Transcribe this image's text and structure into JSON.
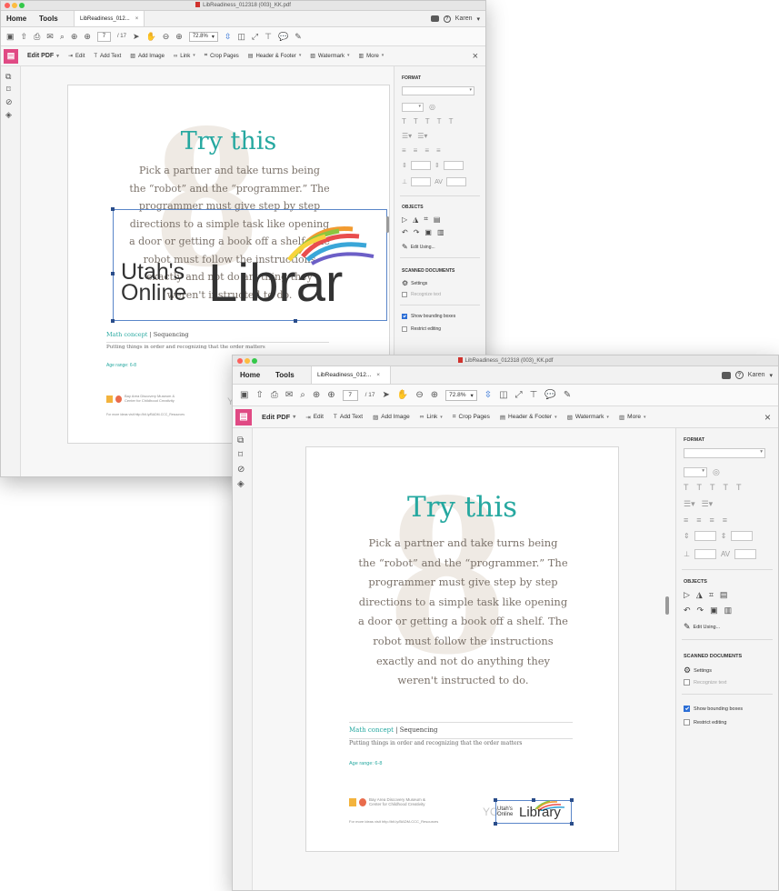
{
  "title": "LibReadiness_012318 (003)_KK.pdf",
  "back_title": "LibReadiness_012318 (003)_KK.pdf",
  "tabs": {
    "home": "Home",
    "tools": "Tools",
    "doc": "LibReadiness_012...",
    "close": "×"
  },
  "user": "Karen",
  "help_glyph": "?",
  "page_current": "7",
  "page_total": "/ 17",
  "zoom": "72.8%",
  "edit": {
    "title": "Edit PDF",
    "edit": "Edit",
    "add_text": "Add Text",
    "add_image": "Add Image",
    "link": "Link",
    "crop": "Crop Pages",
    "header_footer": "Header & Footer",
    "watermark": "Watermark",
    "more": "More",
    "close": "×"
  },
  "doc": {
    "ghost": "8",
    "heading": "Try this",
    "body_lines": [
      "Pick a partner and take turns being",
      "the “robot” and the “programmer.” The",
      "programmer must give step by step",
      "directions to a simple task like opening",
      "a door or getting a book off a shelf. The",
      "robot must follow the instructions",
      "exactly and not do anything they",
      "weren't instructed to do."
    ],
    "concept_label": "Math concept",
    "concept_sep": "|",
    "concept_value": "Sequencing",
    "description": "Putting things in order and recognizing that the order matters",
    "age_range": "Age range: 6-8",
    "museum_line1": "Bay Area Discovery Museum &",
    "museum_line2": "Center for Childhood Creativity",
    "more_ideas": "For more ideas visit http://bit.ly/BADM-CCC_Resources",
    "ghost_yc": "YO"
  },
  "logo": {
    "line1": "Utah's",
    "line2": "Online",
    "big": "Librar",
    "small_big": "Library"
  },
  "panel": {
    "format": "FORMAT",
    "objects": "OBJECTS",
    "edit_using": "Edit Using...",
    "scanned": "SCANNED DOCUMENTS",
    "settings": "Settings",
    "recognize": "Recognize text",
    "show_bbox": "Show bounding boxes",
    "restrict": "Restrict editing",
    "show_bbox_checked": true,
    "restrict_checked": false
  },
  "colors": {
    "accent_teal": "#26a8a0",
    "edit_pink": "#e04a84",
    "link_blue": "#2d6fd6",
    "pdf_red": "#d0322d"
  }
}
